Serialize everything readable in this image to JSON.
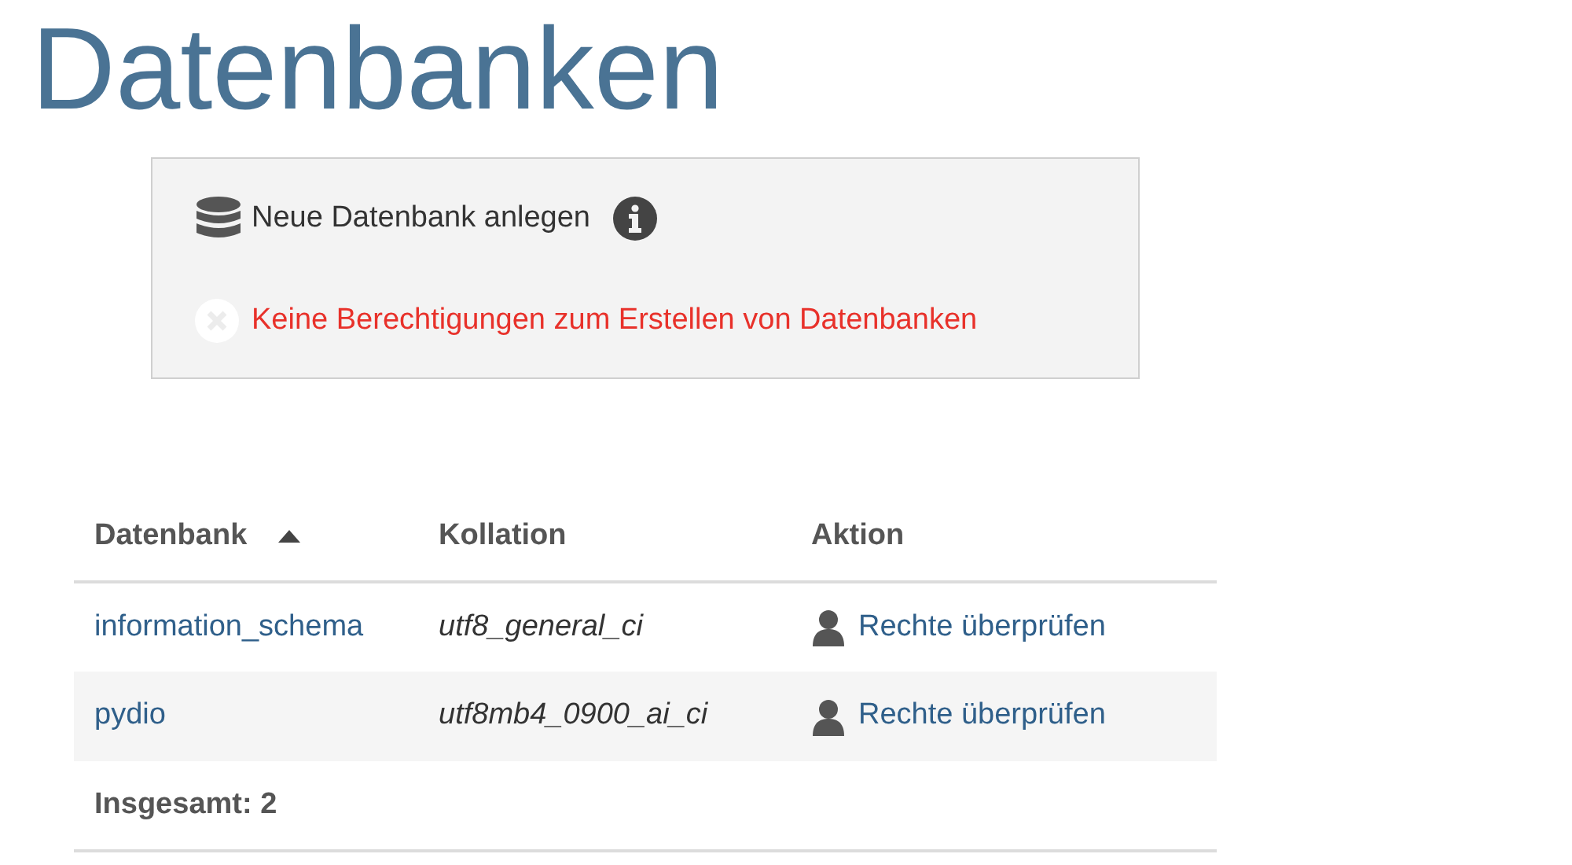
{
  "page_title": "Datenbanken",
  "create_panel": {
    "label": "Neue Datenbank anlegen",
    "error": "Keine Berechtigungen zum Erstellen von Datenbanken"
  },
  "table": {
    "columns": [
      {
        "label": "Datenbank",
        "sorted": true
      },
      {
        "label": "Kollation",
        "sorted": false
      },
      {
        "label": "Aktion",
        "sorted": false
      }
    ],
    "rows": [
      {
        "database": "information_schema",
        "collation": "utf8_general_ci",
        "action": "Rechte überprüfen"
      },
      {
        "database": "pydio",
        "collation": "utf8mb4_0900_ai_ci",
        "action": "Rechte überprüfen"
      }
    ],
    "total": "Insgesamt: 2"
  }
}
